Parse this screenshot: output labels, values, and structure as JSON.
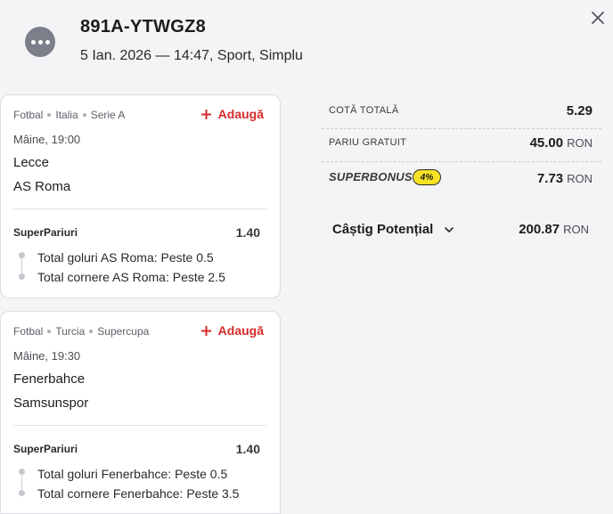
{
  "header": {
    "ticket_id": "891A-YTWGZ8",
    "subtitle": "5 Ian. 2026 — 14:47, Sport, Simplu"
  },
  "events": [
    {
      "sport": "Fotbal",
      "country": "Italia",
      "league": "Serie A",
      "add_label": "Adaugă",
      "time": "Mâine, 19:00",
      "team_home": "Lecce",
      "team_away": "AS Roma",
      "market": "SuperPariuri",
      "odd": "1.40",
      "selections": [
        "Total goluri AS Roma: Peste 0.5",
        "Total cornere AS Roma: Peste 2.5"
      ]
    },
    {
      "sport": "Fotbal",
      "country": "Turcia",
      "league": "Supercupa",
      "add_label": "Adaugă",
      "time": "Mâine, 19:30",
      "team_home": "Fenerbahce",
      "team_away": "Samsunspor",
      "market": "SuperPariuri",
      "odd": "1.40",
      "selections": [
        "Total goluri Fenerbahce: Peste 0.5",
        "Total cornere Fenerbahce: Peste 3.5"
      ]
    }
  ],
  "summary": {
    "total_odds_label": "COTĂ TOTALĂ",
    "total_odds_value": "5.29",
    "free_bet_label": "PARIU GRATUIT",
    "free_bet_value": "45.00",
    "currency": "RON",
    "superbonus_label": "SUPERBONUS",
    "superbonus_percent": "4%",
    "superbonus_value": "7.73",
    "potential_win_label": "Câștig Potențial",
    "potential_win_value": "200.87"
  },
  "colors": {
    "accent_red": "#d42a2a",
    "badge_yellow": "#f7e225",
    "background": "#f4f4f6"
  },
  "icons": [
    "more-icon",
    "close-icon",
    "plus-icon",
    "chevron-down-icon"
  ]
}
